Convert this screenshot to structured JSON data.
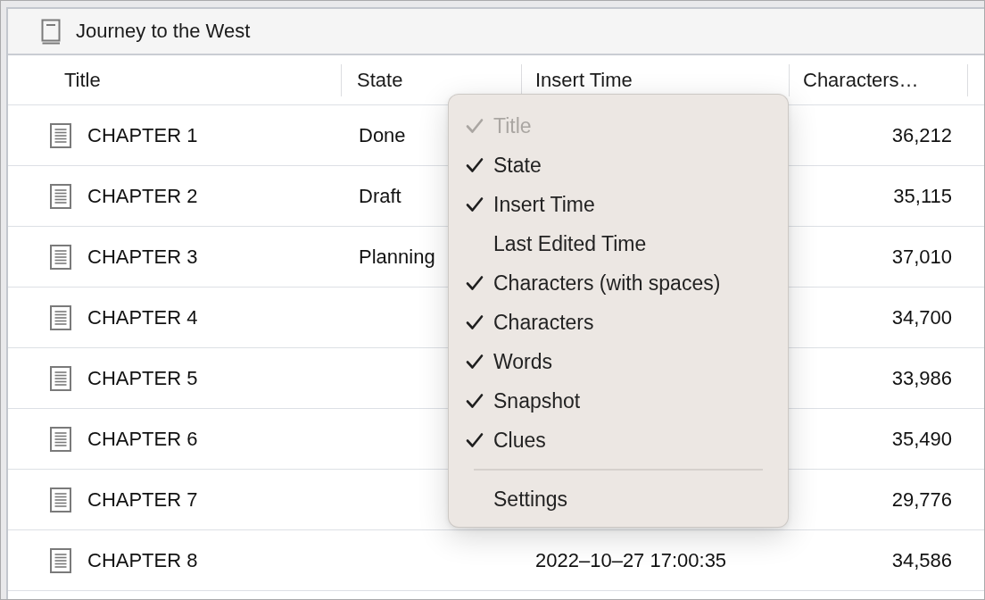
{
  "window": {
    "title": "Journey to the West"
  },
  "table": {
    "columns": [
      {
        "label": "Title"
      },
      {
        "label": "State"
      },
      {
        "label": "Insert Time"
      },
      {
        "label": "Characters…"
      }
    ],
    "rows": [
      {
        "title": "CHAPTER 1",
        "state": "Done",
        "characters": "36,212"
      },
      {
        "title": "CHAPTER 2",
        "state": "Draft",
        "characters": "35,115"
      },
      {
        "title": "CHAPTER 3",
        "state": "Planning",
        "characters": "37,010"
      },
      {
        "title": "CHAPTER 4",
        "characters": "34,700"
      },
      {
        "title": "CHAPTER 5",
        "characters": "33,986"
      },
      {
        "title": "CHAPTER 6",
        "characters": "35,490"
      },
      {
        "title": "CHAPTER 7",
        "characters": "29,776"
      },
      {
        "title": "CHAPTER 8",
        "insert_time": "2022–10–27 17:00:35",
        "characters": "34,586"
      }
    ]
  },
  "column_menu": {
    "items": [
      {
        "kind": "option",
        "label": "Title",
        "checked": true,
        "disabled": true
      },
      {
        "kind": "option",
        "label": "State",
        "checked": true,
        "disabled": false
      },
      {
        "kind": "option",
        "label": "Insert Time",
        "checked": true,
        "disabled": false
      },
      {
        "kind": "option",
        "label": "Last Edited Time",
        "checked": false,
        "disabled": false
      },
      {
        "kind": "option",
        "label": "Characters (with spaces)",
        "checked": true,
        "disabled": false
      },
      {
        "kind": "option",
        "label": "Characters",
        "checked": true,
        "disabled": false
      },
      {
        "kind": "option",
        "label": "Words",
        "checked": true,
        "disabled": false
      },
      {
        "kind": "option",
        "label": "Snapshot",
        "checked": true,
        "disabled": false
      },
      {
        "kind": "option",
        "label": "Clues",
        "checked": true,
        "disabled": false
      },
      {
        "kind": "separator"
      },
      {
        "kind": "action",
        "label": "Settings"
      }
    ]
  }
}
